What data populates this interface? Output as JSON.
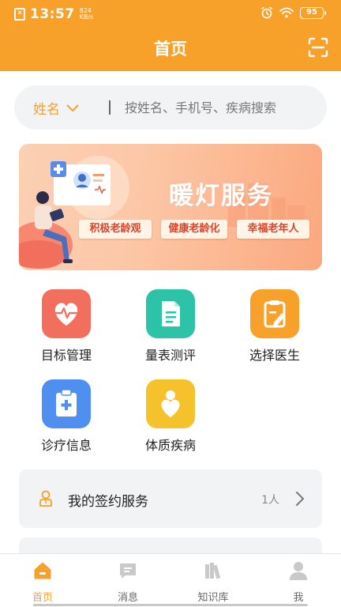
{
  "status": {
    "time": "13:57",
    "speed_value": "824",
    "speed_unit": "KB/s",
    "battery": "95"
  },
  "header": {
    "title": "首页"
  },
  "search": {
    "filter_label": "姓名",
    "placeholder": "按姓名、手机号、疾病搜索"
  },
  "banner": {
    "title": "暖灯服务",
    "tags": [
      "积极老龄观",
      "健康老龄化",
      "幸福老年人"
    ]
  },
  "functions": [
    {
      "label": "目标管理",
      "icon": "heart-pulse-icon",
      "color": "#F26F5E"
    },
    {
      "label": "量表测评",
      "icon": "document-icon",
      "color": "#2DC3A8"
    },
    {
      "label": "选择医生",
      "icon": "clipboard-edit-icon",
      "color": "#F7A12B"
    },
    {
      "label": "诊疗信息",
      "icon": "medical-clipboard-icon",
      "color": "#4E8FF0"
    },
    {
      "label": "体质疾病",
      "icon": "person-heart-icon",
      "color": "#F5C22B"
    }
  ],
  "signed_service": {
    "label": "我的签约服务",
    "count": "1人"
  },
  "tabbar": {
    "items": [
      {
        "label": "首页",
        "active": true
      },
      {
        "label": "消息",
        "active": false
      },
      {
        "label": "知识库",
        "active": false
      },
      {
        "label": "我",
        "active": false
      }
    ]
  },
  "colors": {
    "brand": "#F7A12B",
    "inactive": "#C9C9C9"
  }
}
